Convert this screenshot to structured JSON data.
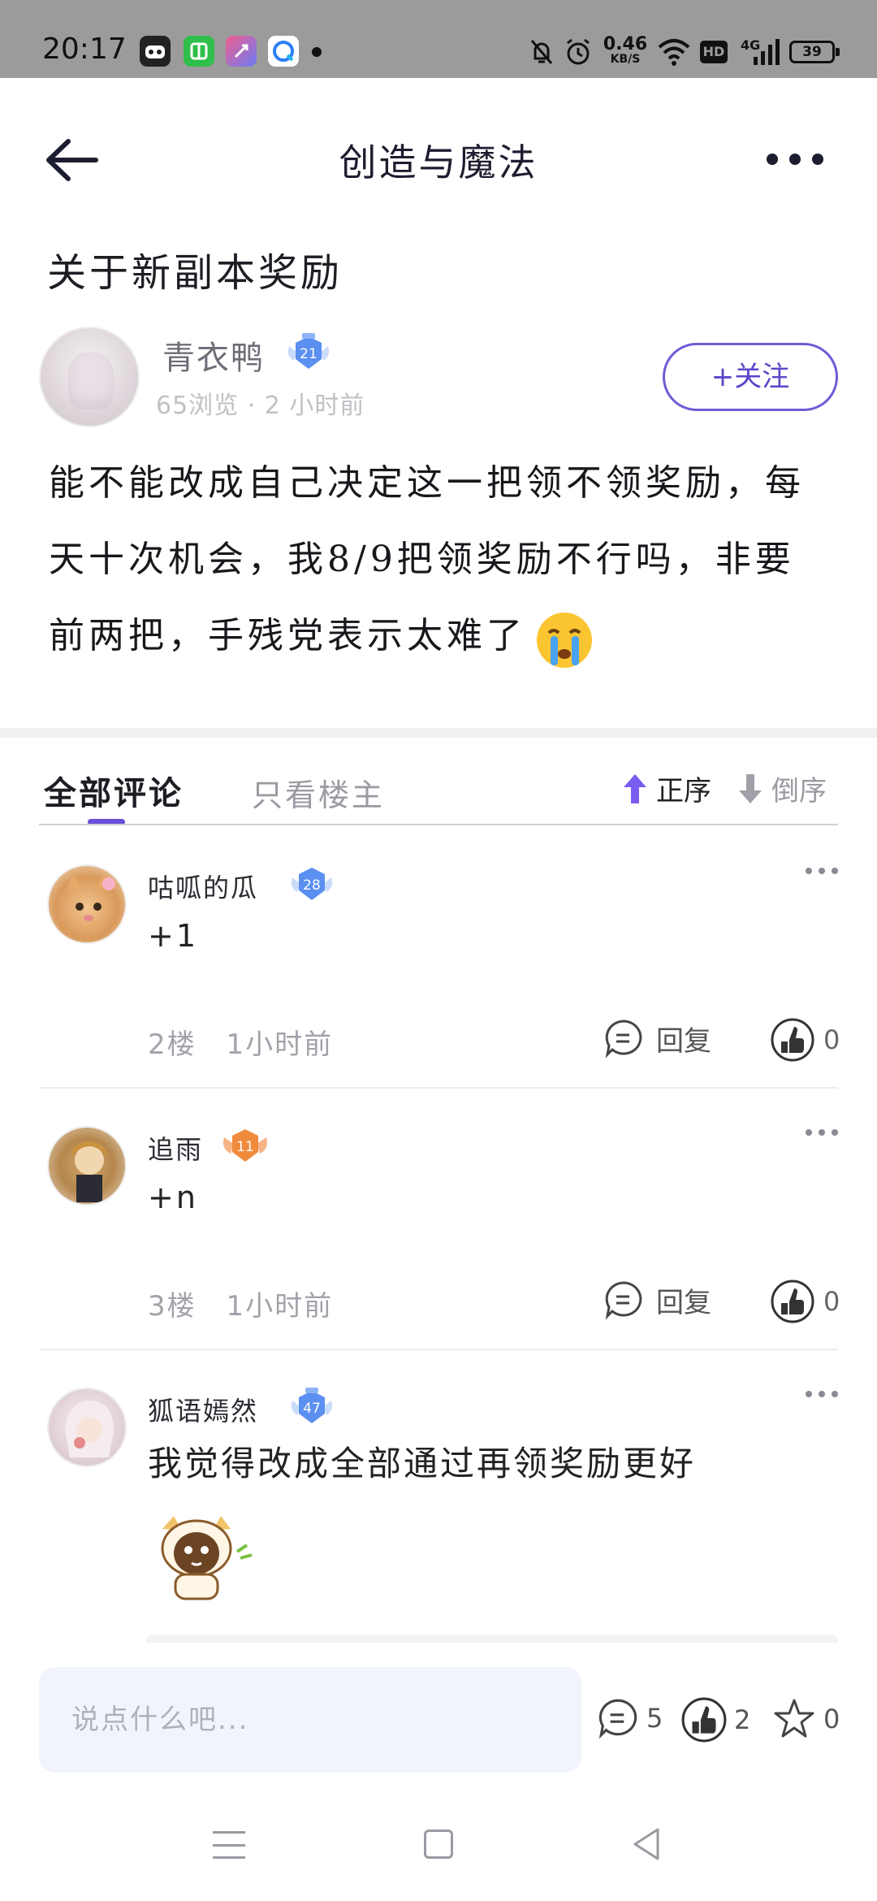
{
  "status_bar": {
    "time": "20:17",
    "net_speed_value": "0.46",
    "net_speed_unit": "KB/S",
    "hd_label": "HD",
    "network_label": "4G",
    "battery_level": "39",
    "icons": [
      "game-app-icon",
      "wechat-icon",
      "shortcut-app-icon",
      "qq-browser-icon",
      "mute-icon",
      "alarm-icon",
      "wifi-icon",
      "signal-icon"
    ]
  },
  "header": {
    "title": "创造与魔法"
  },
  "post": {
    "title": "关于新副本奖励",
    "author": {
      "name": "青衣鸭",
      "level": "21",
      "meta": "65浏览 · 2 小时前"
    },
    "follow_label": "+关注",
    "body": "能不能改成自己决定这一把领不领奖励，每天十次机会，我8/9把领奖励不行吗，非要前两把，手残党表示太难了"
  },
  "comment_tabs": {
    "all_label": "全部评论",
    "owner_only_label": "只看楼主",
    "sort_asc_label": "正序",
    "sort_desc_label": "倒序"
  },
  "comments": [
    {
      "name": "咕呱的瓜",
      "level": "28",
      "text": "+1",
      "floor": "2楼",
      "time": "1小时前",
      "reply_label": "回复",
      "likes": "0"
    },
    {
      "name": "追雨",
      "level": "11",
      "text": "+n",
      "floor": "3楼",
      "time": "1小时前",
      "reply_label": "回复",
      "likes": "0"
    },
    {
      "name": "狐语嫣然",
      "level": "47",
      "text": "我觉得改成全部通过再领奖励更好"
    }
  ],
  "bottom_bar": {
    "input_placeholder": "说点什么吧...",
    "comment_count": "5",
    "like_count": "2",
    "favorite_count": "0"
  },
  "colors": {
    "accent": "#6b4fd8",
    "badge_blue": "#5b8ff0",
    "badge_orange": "#f08a3c",
    "status_bar_bg": "#9b9b9b"
  }
}
